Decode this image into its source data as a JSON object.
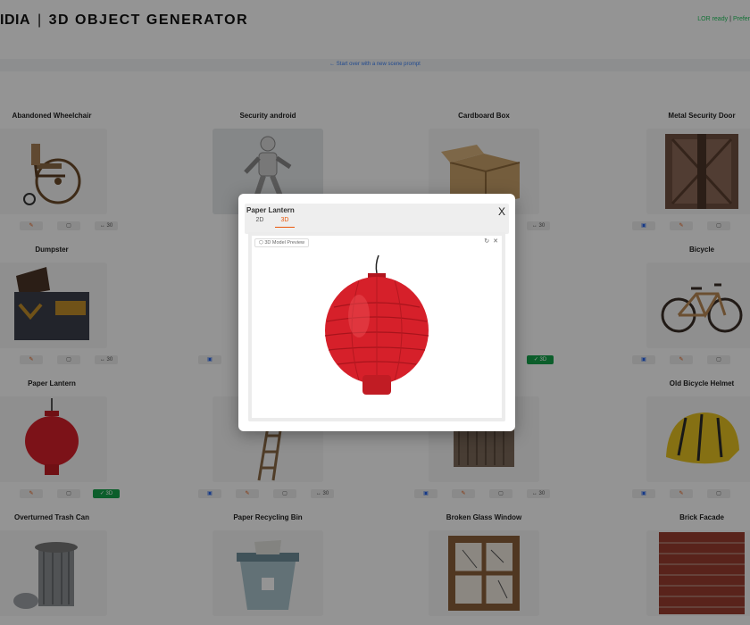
{
  "header": {
    "brand": "IDIA",
    "title": "3D OBJECT GENERATOR",
    "status": "LOR ready",
    "status_sep": "|",
    "status_link": "Prefer"
  },
  "banner": {
    "link": "← Start over with a new scene prompt"
  },
  "buttons": {
    "edit": "✎",
    "copy": "▢",
    "scale": "↔ 30",
    "ok": "✓ 3D",
    "copy_blue": "▣"
  },
  "cards": [
    {
      "title": "Abandoned Wheelchair",
      "icon": "wheelchair-icon"
    },
    {
      "title": "Security android",
      "icon": "robot-icon"
    },
    {
      "title": "Cardboard Box",
      "icon": "box-icon"
    },
    {
      "title": "Metal Security Door",
      "icon": "door-icon"
    },
    {
      "title": "Dumpster",
      "icon": "dumpster-icon"
    },
    {
      "title": "",
      "icon": ""
    },
    {
      "title": "",
      "icon": ""
    },
    {
      "title": "Bicycle",
      "icon": "bicycle-icon"
    },
    {
      "title": "Paper Lantern",
      "icon": "lantern-icon"
    },
    {
      "title": "",
      "icon": "ladder-icon"
    },
    {
      "title": "",
      "icon": "shed-icon"
    },
    {
      "title": "Old Bicycle Helmet",
      "icon": "helmet-icon"
    },
    {
      "title": "Overturned Trash Can",
      "icon": "trash-can-icon"
    },
    {
      "title": "Paper Recycling Bin",
      "icon": "recycle-bin-icon"
    },
    {
      "title": "Broken Glass Window",
      "icon": "window-icon"
    },
    {
      "title": "Brick Facade",
      "icon": "brick-icon"
    }
  ],
  "modal": {
    "title": "Paper Lantern",
    "close": "X",
    "tabs": [
      {
        "label": "2D"
      },
      {
        "label": "3D"
      }
    ],
    "active_tab": "3D",
    "viewer_label": "3D Model Preview",
    "tools": {
      "reset": "↻",
      "close": "✕"
    }
  },
  "colors": {
    "accent": "#ea580c",
    "ok": "#16a34a",
    "link": "#3b82f6",
    "lantern": "#d6202a"
  }
}
